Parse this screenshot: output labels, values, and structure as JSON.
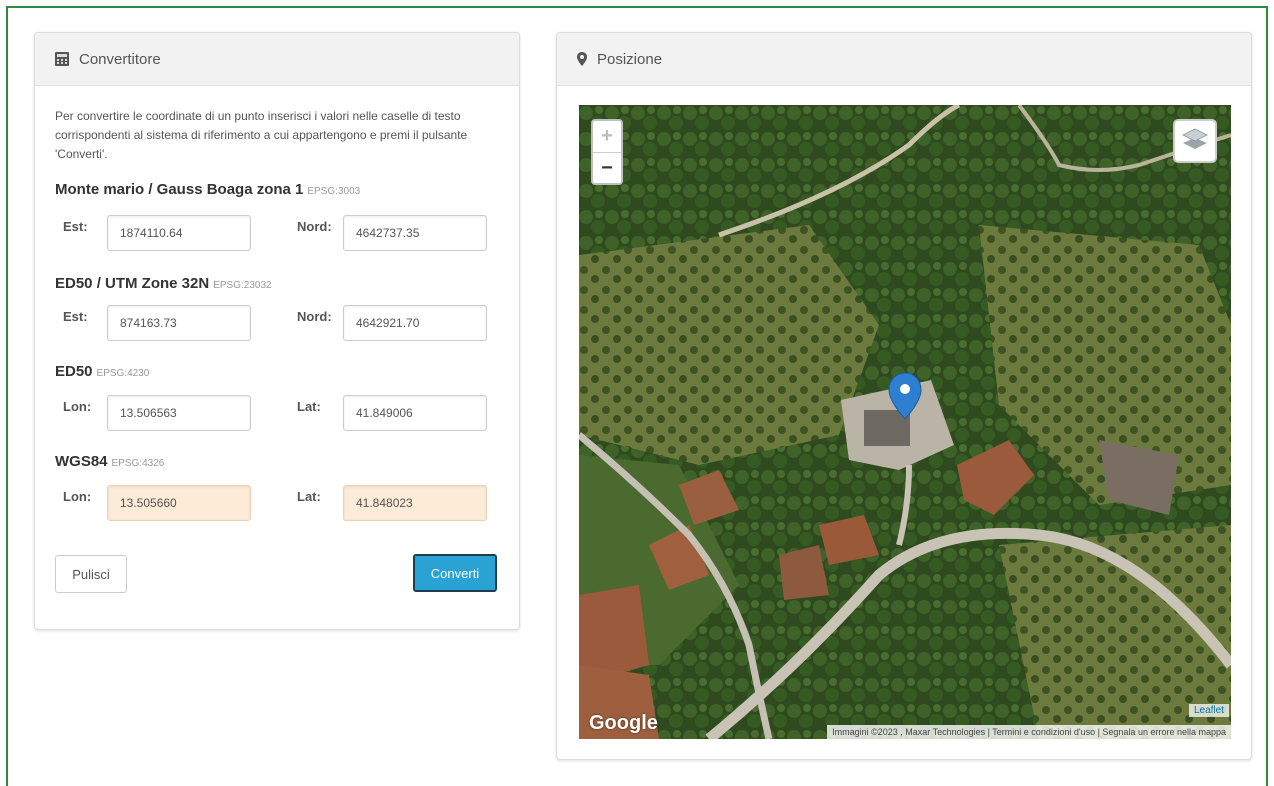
{
  "converter": {
    "title": "Convertitore",
    "intro": "Per convertire le coordinate di un punto inserisci i valori nelle caselle di testo corrispondenti al sistema di riferimento a cui appartengono e premi il pulsante 'Converti'.",
    "systems": [
      {
        "name": "Monte mario / Gauss Boaga zona 1",
        "epsg": "EPSG:3003",
        "fields": [
          {
            "label": "Est:",
            "value": "1874110.64"
          },
          {
            "label": "Nord:",
            "value": "4642737.35"
          }
        ]
      },
      {
        "name": "ED50 / UTM Zone 32N",
        "epsg": "EPSG:23032",
        "fields": [
          {
            "label": "Est:",
            "value": "874163.73"
          },
          {
            "label": "Nord:",
            "value": "4642921.70"
          }
        ]
      },
      {
        "name": "ED50",
        "epsg": "EPSG:4230",
        "fields": [
          {
            "label": "Lon:",
            "value": "13.506563"
          },
          {
            "label": "Lat:",
            "value": "41.849006"
          }
        ]
      },
      {
        "name": "WGS84",
        "epsg": "EPSG:4326",
        "fields": [
          {
            "label": "Lon:",
            "value": "13.505660"
          },
          {
            "label": "Lat:",
            "value": "41.848023"
          }
        ]
      }
    ],
    "clear_label": "Pulisci",
    "convert_label": "Converti",
    "highlight_color": "#fcebd6",
    "accent_color": "#2aa3d4"
  },
  "position": {
    "title": "Posizione",
    "zoom_in": "+",
    "zoom_out": "−",
    "leaflet_label": "Leaflet",
    "google_label": "Google",
    "attribution": "Immagini ©2023 , Maxar Technologies | Termini e condizioni d'uso | Segnala un errore nella mappa"
  }
}
